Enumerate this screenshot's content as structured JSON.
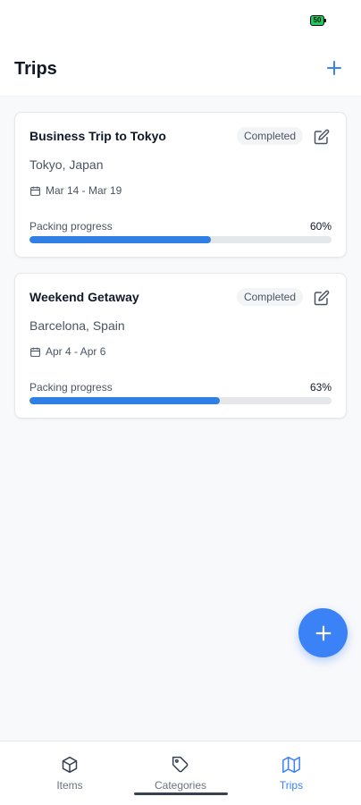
{
  "status_bar": {
    "battery": "50"
  },
  "header": {
    "title": "Trips",
    "add_icon": "plus-icon"
  },
  "trips": [
    {
      "name": "Business Trip to Tokyo",
      "status": "Completed",
      "location": "Tokyo, Japan",
      "dates": "Mar 14 - Mar 19",
      "progress_label": "Packing progress",
      "progress_text": "60%",
      "progress": 0.6
    },
    {
      "name": "Weekend Getaway",
      "status": "Completed",
      "location": "Barcelona, Spain",
      "dates": "Apr 4 - Apr 6",
      "progress_label": "Packing progress",
      "progress_text": "63%",
      "progress": 0.63
    }
  ],
  "nav": {
    "items": [
      {
        "label": "Items",
        "icon": "box-icon"
      },
      {
        "label": "Categories",
        "icon": "tag-icon"
      },
      {
        "label": "Trips",
        "icon": "map-icon",
        "active": true
      }
    ]
  },
  "colors": {
    "accent": "#3b82f6",
    "progress": "#2f7fe5",
    "battery": "#22c55e"
  }
}
